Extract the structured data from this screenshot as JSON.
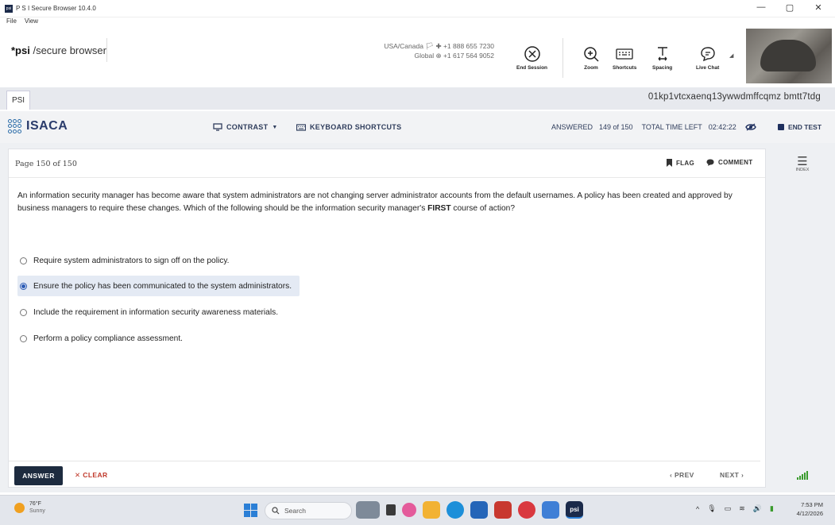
{
  "window": {
    "title": "P S I Secure Browser 10.4.0",
    "app_icon_text": "psi",
    "minimize": "—",
    "restore": "▢",
    "close": "✕"
  },
  "menubar": {
    "items": [
      "File",
      "View"
    ]
  },
  "psi_header": {
    "logo_prefix": "*psi",
    "logo_suffix": " /secure browser",
    "support_line1": "USA/Canada 🏳 ✚ +1 888 655 7230",
    "support_line2": "Global ⊕ +1 617 564 9052",
    "tools": {
      "end_session": "End Session",
      "zoom": "Zoom",
      "shortcuts": "Shortcuts",
      "spacing": "Spacing",
      "live_chat": "Live Chat"
    }
  },
  "psi_strip": {
    "tab_label": "PSI",
    "session_id": "01kp1vtcxaenq13ywwdmffcqmz  bmtt7tdg"
  },
  "exam_bar": {
    "brand": "ISACA",
    "contrast_label": "CONTRAST",
    "keyboard_label": "KEYBOARD SHORTCUTS",
    "answered_label": "ANSWERED",
    "answered_value": "149 of 150",
    "time_label": "TOTAL TIME LEFT",
    "time_value": "02:42:22",
    "end_test_label": "END TEST"
  },
  "question_card": {
    "page_label": "Page 150 of 150",
    "flag_label": "FLAG",
    "comment_label": "COMMENT",
    "question_pre": "An information security manager has become aware that system administrators are not changing server administrator accounts from the default usernames. A policy has been created and approved by business managers to require these changes. Which of the following should be the information security manager's ",
    "question_bold": "FIRST",
    "question_post": " course of action?",
    "options": [
      {
        "label": "Require system administrators to sign off on the policy.",
        "selected": false
      },
      {
        "label": "Ensure the policy has been communicated to the system administrators.",
        "selected": true
      },
      {
        "label": "Include the requirement in information security awareness materials.",
        "selected": false
      },
      {
        "label": "Perform a policy compliance assessment.",
        "selected": false
      }
    ],
    "answer_label": "ANSWER",
    "clear_label": "✕ CLEAR",
    "prev_label": "‹  PREV",
    "next_label": "NEXT  ›"
  },
  "index_panel": {
    "label": "INDEX"
  },
  "taskbar": {
    "temperature": "76°F",
    "weather": "Sunny",
    "search_placeholder": "Search",
    "time": "7:53 PM",
    "date": "4/12/2026"
  },
  "colors": {
    "accent": "#2b5bb5",
    "answer_button": "#1d2b3f",
    "clear": "#c0392b",
    "brand": "#2a3b6b"
  }
}
